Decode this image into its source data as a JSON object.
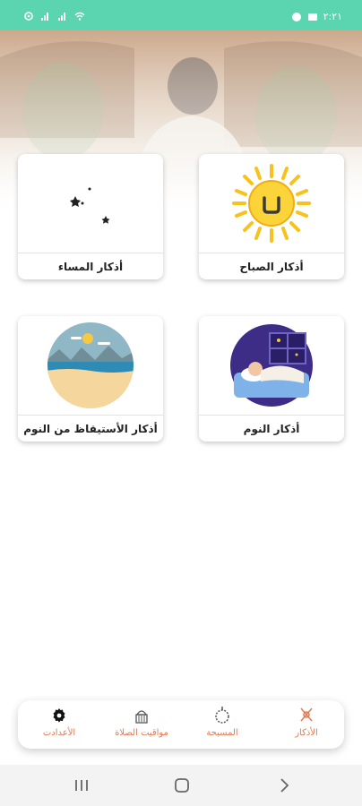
{
  "status_bar": {
    "time": "٢:٢١"
  },
  "cards": [
    {
      "label": "أذكار الصباح",
      "icon": "sun-icon"
    },
    {
      "label": "أذكار المساء",
      "icon": "moon-stars-icon"
    },
    {
      "label": "أذكار النوم",
      "icon": "sleeping-person-icon"
    },
    {
      "label": "أذكار الأستيقاظ من النوم",
      "icon": "beach-scene-icon"
    }
  ],
  "bottom_nav": {
    "items": [
      {
        "label": "الأذكار",
        "icon": "adhkar-icon",
        "active": true
      },
      {
        "label": "المسبحة",
        "icon": "tasbih-icon"
      },
      {
        "label": "مواقيت الصلاة",
        "icon": "mosque-icon"
      },
      {
        "label": "الأعدادت",
        "icon": "gear-icon"
      }
    ]
  },
  "colors": {
    "status_bar": "#5ad5b0",
    "accent": "#e07a53"
  }
}
